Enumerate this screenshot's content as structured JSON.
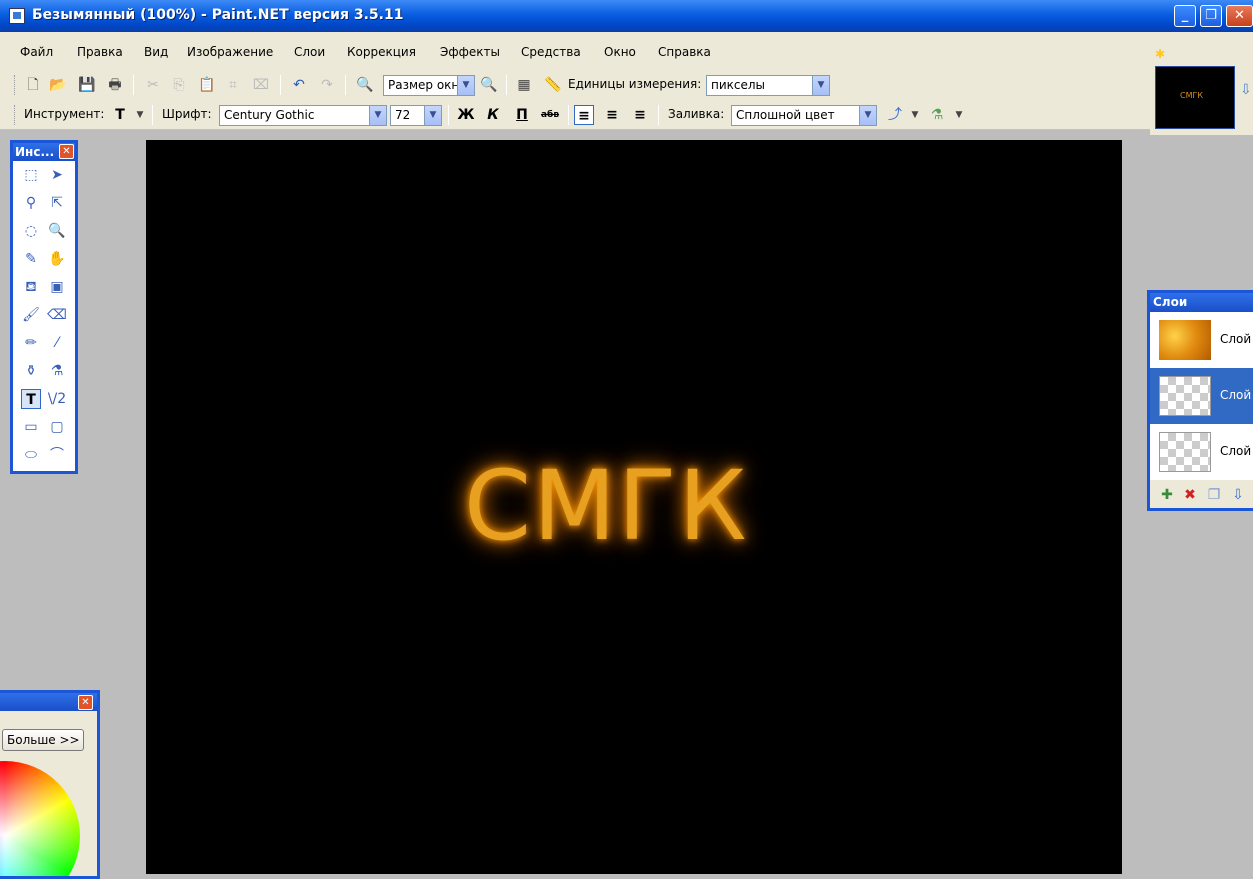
{
  "window": {
    "title": "Безымянный (100%) - Paint.NET версия 3.5.11",
    "min_glyph": "_",
    "max_glyph": "❐",
    "close_glyph": "✕"
  },
  "menu": {
    "items": [
      "Файл",
      "Правка",
      "Вид",
      "Изображение",
      "Слои",
      "Коррекция",
      "Эффекты",
      "Средства",
      "Окно",
      "Справка"
    ]
  },
  "toolbar": {
    "zoom_value": "Размер окн",
    "units_label": "Единицы измерения:",
    "units_value": "пикселы",
    "tool_label": "Инструмент:",
    "font_label": "Шрифт:",
    "font_value": "Century Gothic",
    "size_value": "72",
    "bold": "Ж",
    "italic": "К",
    "underline": "П",
    "strike": "абв",
    "fill_label": "Заливка:",
    "fill_value": "Сплошной цвет"
  },
  "canvas": {
    "text": "СМГК",
    "glow_color": "#e8a020"
  },
  "thumbnail": {
    "text": "СМГК"
  },
  "tools_panel": {
    "title": "Инс...",
    "close_glyph": "✕",
    "tools": [
      {
        "name": "rectangle-select-tool",
        "glyph": "⬚"
      },
      {
        "name": "move-selection-tool",
        "glyph": "➤"
      },
      {
        "name": "lasso-select-tool",
        "glyph": "⚲"
      },
      {
        "name": "move-selected-tool",
        "glyph": "⇱"
      },
      {
        "name": "ellipse-select-tool",
        "glyph": "◌"
      },
      {
        "name": "zoom-tool",
        "glyph": "🔍"
      },
      {
        "name": "magic-wand-tool",
        "glyph": "✎"
      },
      {
        "name": "pan-tool",
        "glyph": "✋"
      },
      {
        "name": "paint-bucket-tool",
        "glyph": "⛾"
      },
      {
        "name": "gradient-tool",
        "glyph": "▣"
      },
      {
        "name": "paintbrush-tool",
        "glyph": "🖌"
      },
      {
        "name": "eraser-tool",
        "glyph": "⌫"
      },
      {
        "name": "pencil-tool",
        "glyph": "✏"
      },
      {
        "name": "color-picker-tool",
        "glyph": "⁄"
      },
      {
        "name": "clone-stamp-tool",
        "glyph": "⚱"
      },
      {
        "name": "recolor-tool",
        "glyph": "⚗"
      },
      {
        "name": "text-tool",
        "glyph": "T"
      },
      {
        "name": "line-curve-tool",
        "glyph": "\\/2"
      },
      {
        "name": "rectangle-tool",
        "glyph": "▭"
      },
      {
        "name": "rounded-rectangle-tool",
        "glyph": "▢"
      },
      {
        "name": "ellipse-tool",
        "glyph": "⬭"
      },
      {
        "name": "freeform-shape-tool",
        "glyph": "⌒"
      }
    ]
  },
  "colors_panel": {
    "close_glyph": "✕",
    "more_button": "Больше >>"
  },
  "layers_panel": {
    "title": "Слои",
    "layers": [
      {
        "name": "Слой",
        "thumb": "fire"
      },
      {
        "name": "Слой",
        "thumb": "checker",
        "selected": true
      },
      {
        "name": "Слой",
        "thumb": "checker"
      }
    ]
  },
  "colors": {
    "titlebar_blue": "#0a5ee0",
    "panel_border": "#1b56d8",
    "selection": "#316ac5",
    "chrome": "#ece9d8",
    "workspace": "#bdbdbd"
  }
}
